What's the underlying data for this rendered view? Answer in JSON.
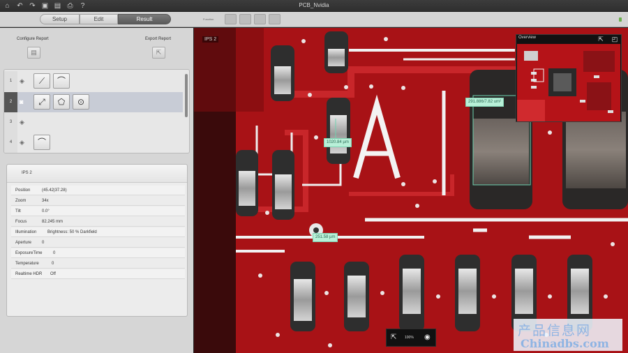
{
  "app": {
    "title": "PCB_Nvidia"
  },
  "toolbar_icons": [
    "home-icon",
    "undo-icon",
    "redo-icon",
    "save-icon",
    "save-as-icon",
    "print-icon",
    "help-icon"
  ],
  "help_glyph": "?",
  "modes": [
    {
      "label": "Setup",
      "active": false
    },
    {
      "label": "Edit",
      "active": false
    },
    {
      "label": "Result",
      "active": true
    }
  ],
  "function_label": "Function",
  "left": {
    "configure_report": "Configure Report",
    "export_report": "Export Report",
    "rows": [
      {
        "num": "1"
      },
      {
        "num": "2"
      },
      {
        "num": "3"
      },
      {
        "num": "4"
      }
    ],
    "info": {
      "title": "IPS 2",
      "rows": [
        {
          "key": "Position",
          "value": "(45.42|37.28)"
        },
        {
          "key": "Zoom",
          "value": "34x"
        },
        {
          "key": "Tilt",
          "value": "0.0°"
        },
        {
          "key": "Focus",
          "value": "82.245 mm"
        },
        {
          "key": "Illumination",
          "value": "Brightness: 50 % Darkfield"
        },
        {
          "key": "Aperture",
          "value": "0"
        },
        {
          "key": "ExposureTime",
          "value": "0"
        },
        {
          "key": "Temperature",
          "value": "0"
        },
        {
          "key": "Realtime HDR",
          "value": "Off"
        }
      ]
    }
  },
  "viewer": {
    "label": "IPS 2",
    "measurements": {
      "length": "1020.84 µm",
      "area": "291.886/7.82 um²",
      "circle": "251.58 µm"
    },
    "overview_title": "Overview",
    "zoom": "100%"
  },
  "watermark": {
    "cn": "产品信息网",
    "en": "Chinadbs.com"
  },
  "colors": {
    "pcb_red": "#a81216",
    "measure_green": "#b8f0d8",
    "accent": "#5a5a5a"
  }
}
